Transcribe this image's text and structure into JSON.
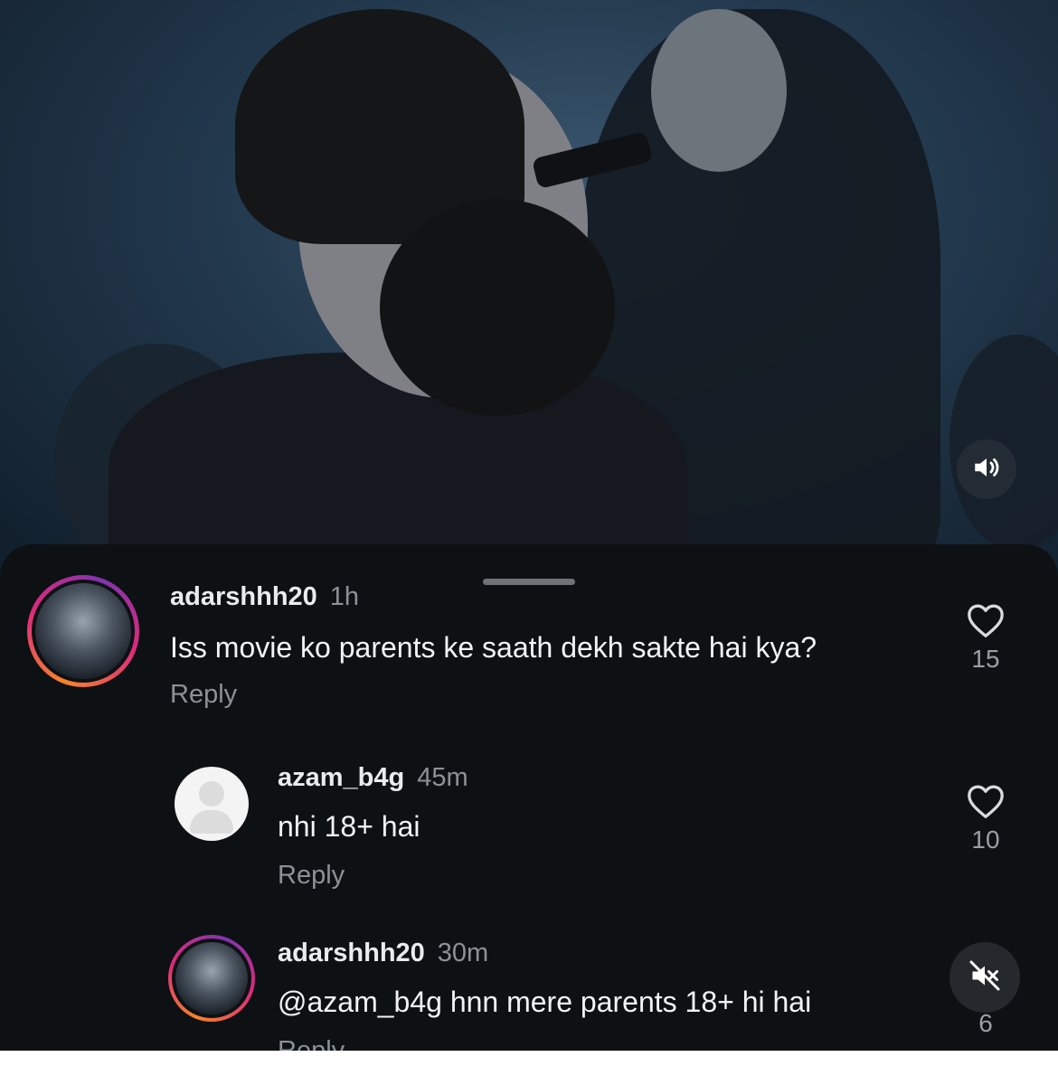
{
  "comments": [
    {
      "username": "adarshhh20",
      "time": "1h",
      "text": "Iss movie ko parents ke saath dekh sakte hai kya?",
      "reply_label": "Reply",
      "likes": "15"
    },
    {
      "username": "azam_b4g",
      "time": "45m",
      "text": "nhi 18+ hai",
      "reply_label": "Reply",
      "likes": "10"
    },
    {
      "username": "adarshhh20",
      "time": "30m",
      "text": "@azam_b4g hnn mere parents 18+ hi hai",
      "reply_label": "Reply",
      "likes": "6"
    }
  ],
  "icons": {
    "video_sound": "volume-icon",
    "like": "heart-icon",
    "mute": "muted-speaker-icon"
  },
  "colors": {
    "sheet_background": "#0e1114",
    "story_ring": "#dd2a7b",
    "username": "#e9ebee",
    "meta": "#8c9196"
  }
}
